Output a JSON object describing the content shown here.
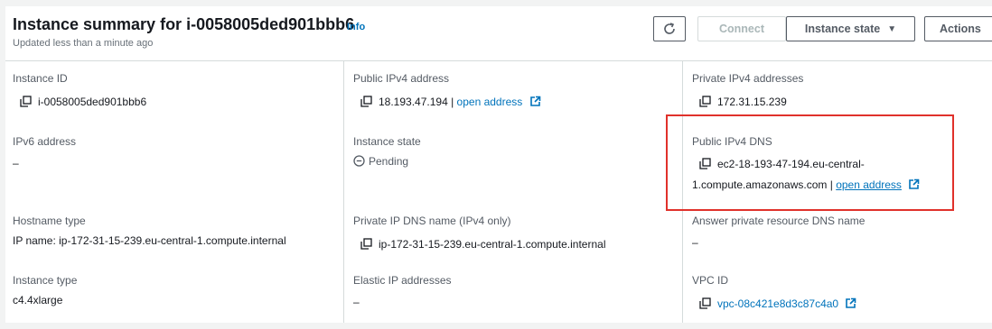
{
  "header": {
    "title": "Instance summary for i-0058005ded901bbb6",
    "subtitle": "Updated less than a minute ago",
    "info_label": "Info",
    "refresh_icon": "refresh-icon",
    "connect_label": "Connect",
    "instance_state_label": "Instance state",
    "actions_label": "Actions"
  },
  "fields": {
    "instance_id": {
      "label": "Instance ID",
      "value": "i-0058005ded901bbb6"
    },
    "public_ipv4": {
      "label": "Public IPv4 address",
      "value": "18.193.47.194",
      "separator": " | ",
      "link": "open address"
    },
    "private_ipv4": {
      "label": "Private IPv4 addresses",
      "value": "172.31.15.239"
    },
    "ipv6": {
      "label": "IPv6 address",
      "value": "–"
    },
    "instance_state": {
      "label": "Instance state",
      "value": "Pending"
    },
    "public_dns": {
      "label": "Public IPv4 DNS",
      "value_line1": "ec2-18-193-47-194.eu-central-",
      "value_line2": "1.compute.amazonaws.com",
      "separator": " | ",
      "link": "open address"
    },
    "hostname_type": {
      "label": "Hostname type",
      "value": "IP name: ip-172-31-15-239.eu-central-1.compute.internal"
    },
    "private_dns": {
      "label": "Private IP DNS name (IPv4 only)",
      "value": "ip-172-31-15-239.eu-central-1.compute.internal"
    },
    "answer_private_dns": {
      "label": "Answer private resource DNS name",
      "value": "–"
    },
    "instance_type": {
      "label": "Instance type",
      "value": "c4.4xlarge"
    },
    "elastic_ip": {
      "label": "Elastic IP addresses",
      "value": "–"
    },
    "vpc_id": {
      "label": "VPC ID",
      "value": "vpc-08c421e8d3c87c4a0"
    }
  },
  "colors": {
    "link": "#0073bb",
    "highlight": "#e0312b",
    "border": "#d5dbdb"
  }
}
